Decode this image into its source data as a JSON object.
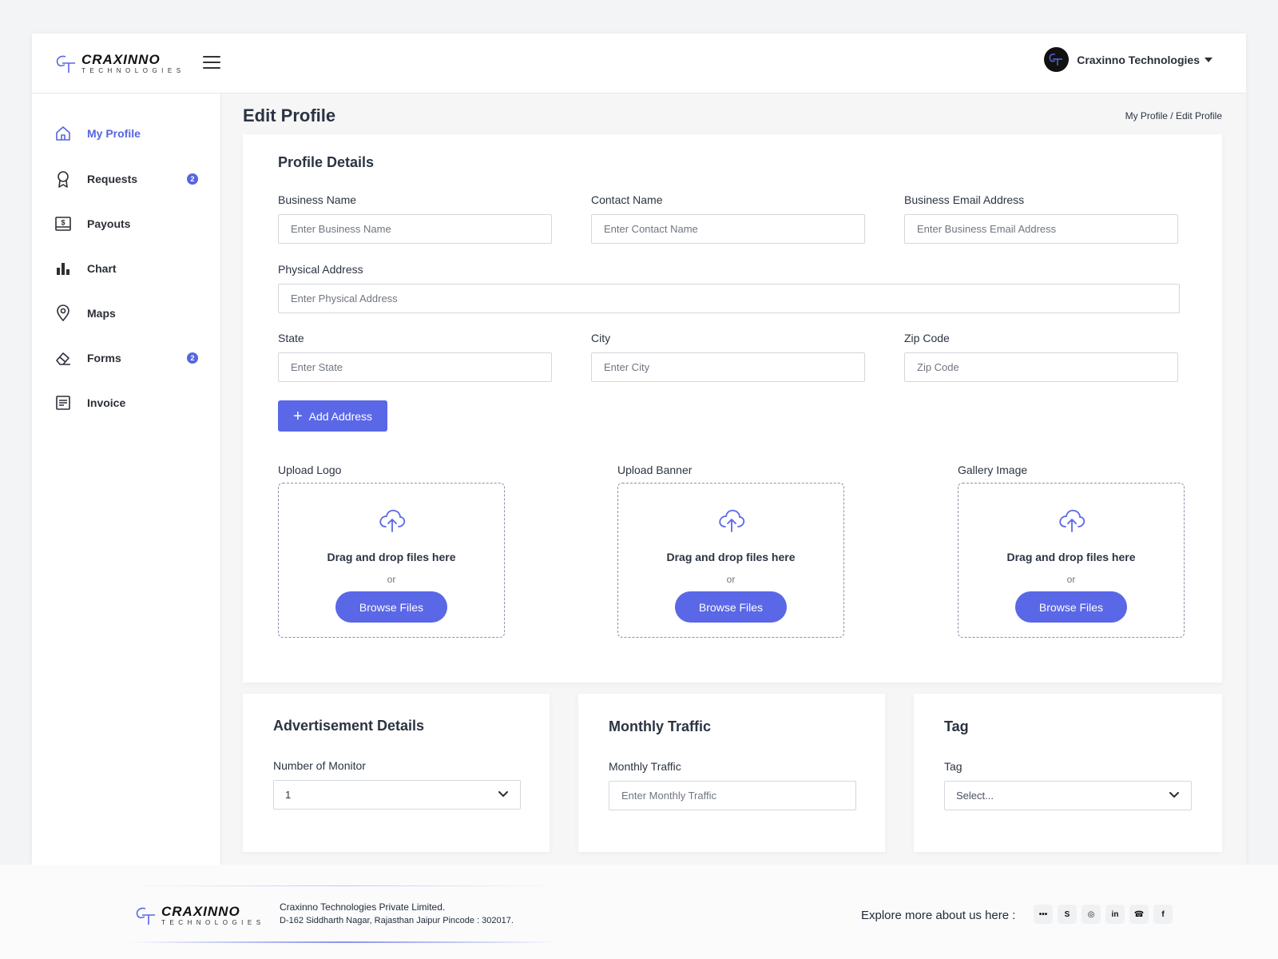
{
  "header": {
    "logo_word": "CRAXINNO",
    "logo_sub": "TECHNOLOGIES",
    "user_name": "Craxinno Technologies"
  },
  "sidebar": {
    "items": [
      {
        "label": "My Profile",
        "icon": "home-icon",
        "active": true
      },
      {
        "label": "Requests",
        "icon": "award-icon",
        "badge": "2"
      },
      {
        "label": "Payouts",
        "icon": "dollar-icon"
      },
      {
        "label": "Chart",
        "icon": "bar-chart-icon"
      },
      {
        "label": "Maps",
        "icon": "map-pin-icon"
      },
      {
        "label": "Forms",
        "icon": "eraser-icon",
        "badge": "2"
      },
      {
        "label": "Invoice",
        "icon": "invoice-icon"
      }
    ]
  },
  "page": {
    "title": "Edit Profile",
    "breadcrumb_1": "My Profile",
    "breadcrumb_sep": "/",
    "breadcrumb_2": "Edit Profile"
  },
  "profile": {
    "title": "Profile Details",
    "business_name": {
      "label": "Business Name",
      "placeholder": "Enter Business Name"
    },
    "contact_name": {
      "label": "Contact Name",
      "placeholder": "Enter Contact Name"
    },
    "business_email": {
      "label": "Business Email Address",
      "placeholder": "Enter Business Email Address"
    },
    "physical_address": {
      "label": "Physical Address",
      "placeholder": "Enter Physical Address"
    },
    "state": {
      "label": "State",
      "placeholder": "Enter State"
    },
    "city": {
      "label": "City",
      "placeholder": "Enter City"
    },
    "zip": {
      "label": "Zip Code",
      "placeholder": "Zip Code"
    },
    "add_address": "Add Address"
  },
  "uploads": [
    {
      "label": "Upload Logo",
      "drag": "Drag and drop files here",
      "or": "or",
      "button": "Browse Files"
    },
    {
      "label": "Upload Banner",
      "drag": "Drag and drop files here",
      "or": "or",
      "button": "Browse Files"
    },
    {
      "label": "Gallery Image",
      "drag": "Drag and drop files here",
      "or": "or",
      "button": "Browse Files"
    }
  ],
  "advertisement": {
    "title": "Advertisement Details",
    "monitor_label": "Number of Monitor",
    "monitor_value": "1"
  },
  "traffic": {
    "title": "Monthly Traffic",
    "label": "Monthly Traffic",
    "placeholder": "Enter Monthly Traffic"
  },
  "tag": {
    "title": "Tag",
    "label": "Tag",
    "placeholder": "Select..."
  },
  "footer": {
    "logo_word": "CRAXINNO",
    "logo_sub": "TECHNOLOGIES",
    "company": "Craxinno Technologies Private Limited.",
    "address": "D-162 Siddharth Nagar, Rajasthan Jaipur Pincode : 302017.",
    "explore": "Explore more about us here :",
    "social": [
      {
        "icon": "dots-icon",
        "glyph": "•••"
      },
      {
        "icon": "skype-icon",
        "glyph": "S"
      },
      {
        "icon": "instagram-icon",
        "glyph": "◎"
      },
      {
        "icon": "linkedin-icon",
        "glyph": "in"
      },
      {
        "icon": "whatsapp-icon",
        "glyph": "☎"
      },
      {
        "icon": "facebook-icon",
        "glyph": "f"
      }
    ]
  },
  "colors": {
    "accent": "#5a67e6",
    "text": "#2b3442"
  }
}
